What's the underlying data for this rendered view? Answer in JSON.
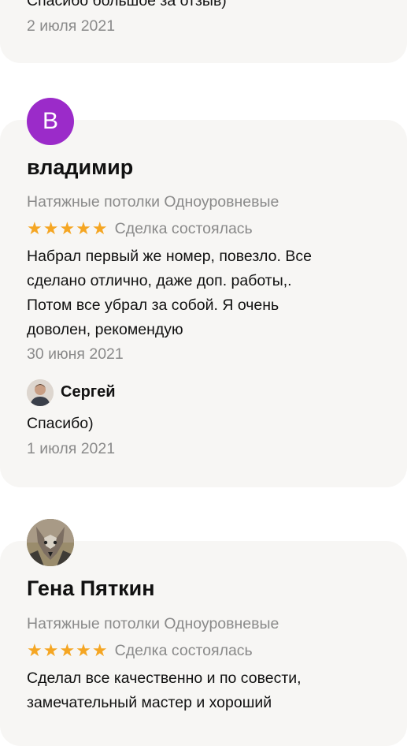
{
  "top_review": {
    "text_partial": "Спасибо большое за отзыв)",
    "date": "2 июля 2021"
  },
  "review_1": {
    "avatar_letter": "В",
    "avatar_color": "#9b2bc9",
    "author": "владимир",
    "service": "Натяжные потолки Одноуровневые",
    "stars": "★★★★★",
    "status": "Сделка состоялась",
    "text_lines": [
      "Набрал первый же номер, повезло. Все",
      "сделано отлично, даже доп. работы,.",
      "Потом все убрал за собой. Я очень",
      "доволен, рекомендую"
    ],
    "date": "30 июня 2021",
    "reply": {
      "author": "Сергей",
      "text": "Спасибо)",
      "date": "1 июля 2021"
    }
  },
  "review_2": {
    "avatar_icon": "wolf-avatar-icon",
    "author": "Гена Пяткин",
    "service": "Натяжные потолки Одноуровневые",
    "stars": "★★★★★",
    "status": "Сделка состоялась",
    "text_lines": [
      "Сделал все качественно и по совести,",
      "замечательный мастер и хороший"
    ]
  },
  "colors": {
    "star": "#f5a623",
    "card_bg": "#f7f6f4",
    "muted_text": "#8a8a8a"
  }
}
